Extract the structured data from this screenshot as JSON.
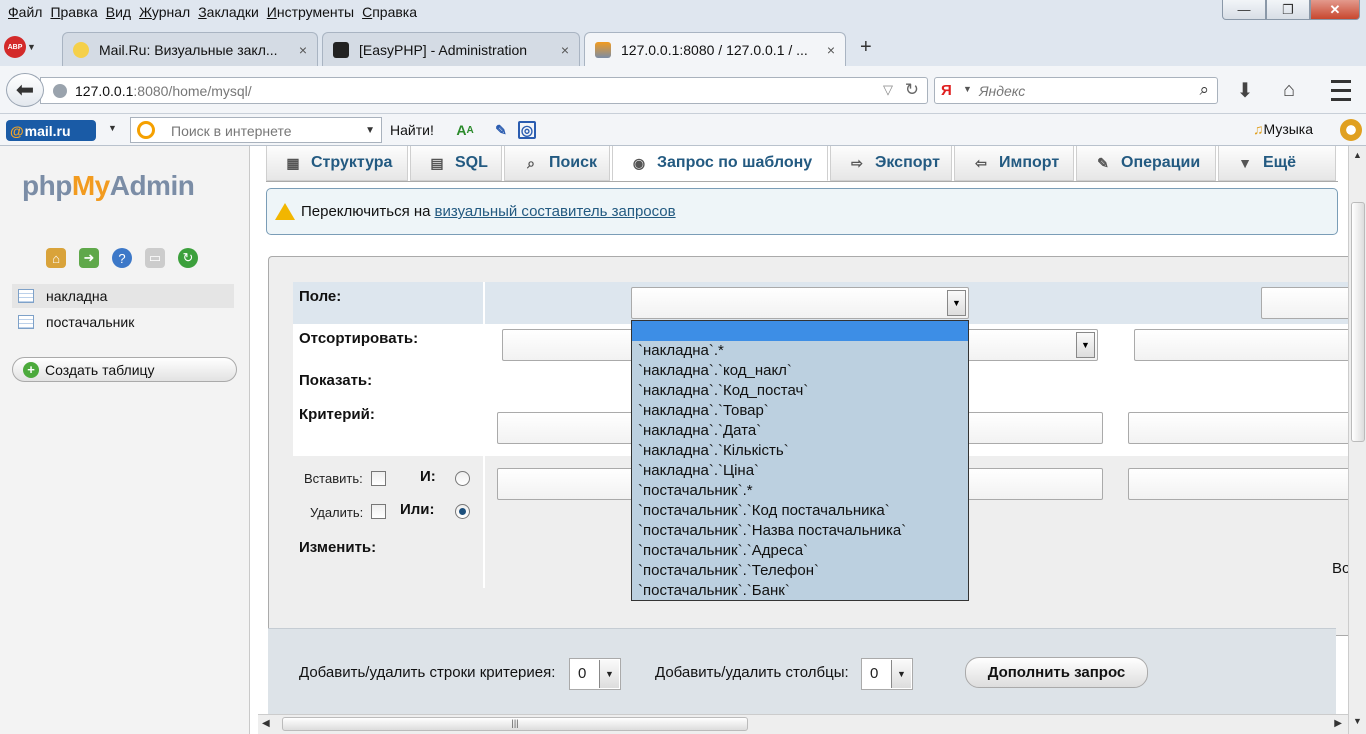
{
  "menu": [
    "Файл",
    "Правка",
    "Вид",
    "Журнал",
    "Закладки",
    "Инструменты",
    "Справка"
  ],
  "window_buttons": {
    "minimize": "—",
    "maximize": "❐",
    "close": "✕"
  },
  "abp_label": "ABP",
  "tabs": [
    {
      "title": "Mail.Ru: Визуальные закл...",
      "close": "×"
    },
    {
      "title": "[EasyPHP] - Administration",
      "close": "×"
    },
    {
      "title": "127.0.0.1:8080 / 127.0.0.1 / ...",
      "close": "×"
    }
  ],
  "new_tab": "+",
  "url": {
    "host": "127.0.0.1",
    "rest": ":8080/home/mysql/"
  },
  "search": {
    "engine": "Я",
    "placeholder": "Яндекс"
  },
  "toolbar": {
    "mailru": "mail.ru",
    "websearch_placeholder": "Поиск в интернете",
    "go": "Найти!",
    "music": "Музыка"
  },
  "sidebar": {
    "logo_php": "php",
    "logo_my": "My",
    "logo_admin": "Admin",
    "tables": [
      "накладна",
      "постачальник"
    ],
    "create_table": "Создать таблицу"
  },
  "pma_tabs": [
    {
      "label": "Структура",
      "icon": "structure-icon"
    },
    {
      "label": "SQL",
      "icon": "sql-icon"
    },
    {
      "label": "Поиск",
      "icon": "search-icon"
    },
    {
      "label": "Запрос по шаблону",
      "icon": "query-icon"
    },
    {
      "label": "Экспорт",
      "icon": "export-icon"
    },
    {
      "label": "Импорт",
      "icon": "import-icon"
    },
    {
      "label": "Операции",
      "icon": "wrench-icon"
    },
    {
      "label": "Ещё",
      "icon": "more-icon"
    }
  ],
  "notice": {
    "text": "Переключиться на",
    "link": "визуальный составитель запросов"
  },
  "form": {
    "field": "Поле:",
    "sort": "Отсортировать:",
    "show": "Показать:",
    "criteria": "Критерий:",
    "insert": "Вставить:",
    "delete": "Удалить:",
    "and": "И:",
    "or": "Или:",
    "modify": "Изменить:",
    "truncated": "Во"
  },
  "field_options": [
    "`накладна`.*",
    "`накладна`.`код_накл`",
    "`накладна`.`Код_постач`",
    "`накладна`.`Товар`",
    "`накладна`.`Дата`",
    "`накладна`.`Кількість`",
    "`накладна`.`Ціна`",
    "`постачальник`.*",
    "`постачальник`.`Код постачальника`",
    "`постачальник`.`Назва постачальника`",
    "`постачальник`.`Адреса`",
    "`постачальник`.`Телефон`",
    "`постачальник`.`Банк`"
  ],
  "bottom": {
    "rows_label": "Добавить/удалить строки критериея:",
    "rows_value": "0",
    "cols_label": "Добавить/удалить столбцы:",
    "cols_value": "0",
    "submit": "Дополнить запрос"
  },
  "colors": {
    "link": "#235a81",
    "highlight": "#3d8ee6",
    "dropdown_bg": "#bcd0e0"
  }
}
